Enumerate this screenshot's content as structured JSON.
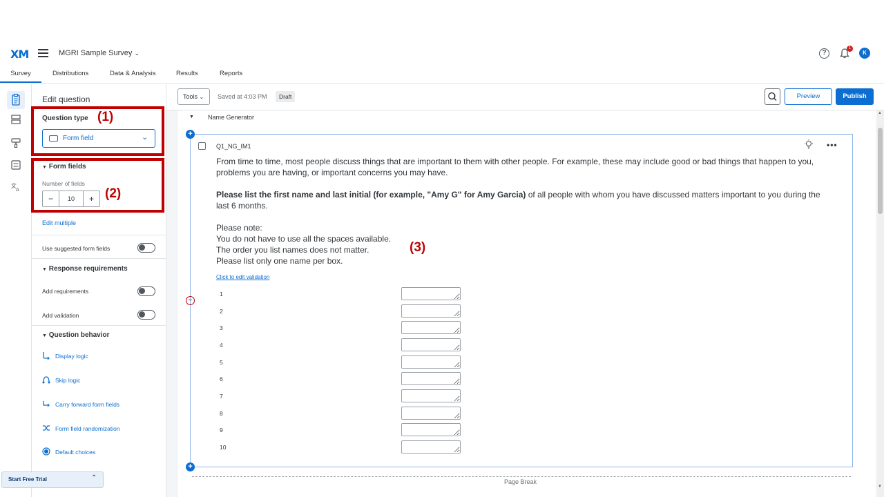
{
  "header": {
    "logo": "XM",
    "survey_title": "MGRI Sample Survey",
    "notification_count": "1",
    "avatar_initial": "K"
  },
  "tabs": [
    {
      "label": "Survey",
      "active": true
    },
    {
      "label": "Distributions"
    },
    {
      "label": "Data & Analysis"
    },
    {
      "label": "Results"
    },
    {
      "label": "Reports"
    }
  ],
  "panel": {
    "title": "Edit question",
    "question_type_label": "Question type",
    "question_type_value": "Form field",
    "form_fields_label": "Form fields",
    "number_of_fields_label": "Number of fields",
    "number_of_fields_value": "10",
    "minus": "−",
    "plus": "+",
    "edit_multiple": "Edit multiple",
    "use_suggested": "Use suggested form fields",
    "response_requirements": "Response requirements",
    "add_requirements": "Add requirements",
    "add_validation": "Add validation",
    "question_behavior": "Question behavior",
    "behavior_links": [
      "Display logic",
      "Skip logic",
      "Carry forward form fields",
      "Form field randomization",
      "Default choices"
    ],
    "start_free_trial": "Start Free Trial"
  },
  "toolbar": {
    "tools": "Tools",
    "saved": "Saved at 4:03 PM",
    "status": "Draft",
    "preview": "Preview",
    "publish": "Publish"
  },
  "block": {
    "name": "Name Generator",
    "page_break": "Page Break"
  },
  "question": {
    "id": "Q1_NG_IM1",
    "text_para1": "From time to time, most people discuss things that are important to them with other people. For example, these may include good or bad things that happen to you, problems you are having, or important concerns you may have.",
    "text_bold": "Please list the first name and last initial (for example, \"Amy G\" for Amy Garcia)",
    "text_rest": " of all people with whom you have discussed matters important to you during the last 6 months.",
    "note_title": "Please note:",
    "note_lines": [
      "You do not have to use all the spaces available.",
      "The order you list names does not matter.",
      "Please list only one name per box."
    ],
    "validation_link": "Click to edit validation",
    "rows": [
      "1",
      "2",
      "3",
      "4",
      "5",
      "6",
      "7",
      "8",
      "9",
      "10"
    ]
  },
  "annotations": [
    "(1)",
    "(2)",
    "(3)"
  ],
  "colors": {
    "accent": "#0b6ed0",
    "annotation": "#c00000"
  }
}
